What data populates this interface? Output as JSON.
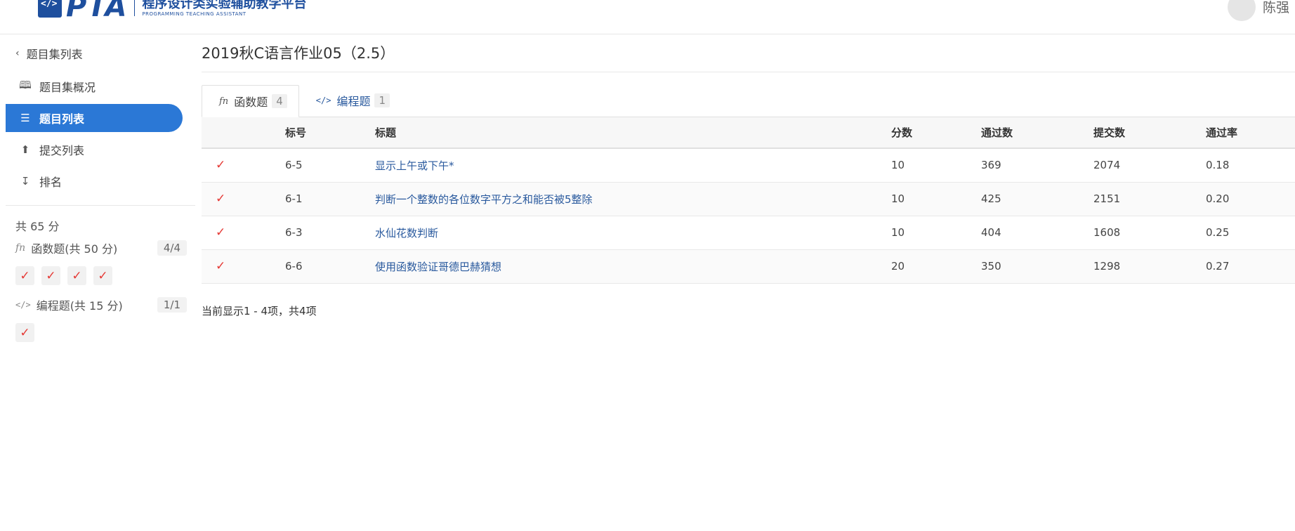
{
  "header": {
    "logo_text": "PTA",
    "logo_title": "程序设计类实验辅助教学平台",
    "logo_subtitle": "PROGRAMMING TEACHING ASSISTANT",
    "user_name": "陈强"
  },
  "sidebar": {
    "back_label": "题目集列表",
    "items": [
      {
        "label": "题目集概况",
        "icon": "book-icon"
      },
      {
        "label": "题目列表",
        "icon": "list-icon",
        "active": true
      },
      {
        "label": "提交列表",
        "icon": "upload-icon"
      },
      {
        "label": "排名",
        "icon": "sort-icon"
      }
    ],
    "total_score": "共 65 分",
    "groups": [
      {
        "label": "函数题(共 50 分)",
        "icon": "fn",
        "badge": "4/4",
        "checks": 4
      },
      {
        "label": "编程题(共 15 分)",
        "icon": "</>",
        "badge": "1/1",
        "checks": 1
      }
    ]
  },
  "main": {
    "title": "2019秋C语言作业05（2.5）",
    "tabs": [
      {
        "label": "函数题",
        "icon": "fn",
        "count": "4",
        "active": true
      },
      {
        "label": "编程题",
        "icon": "</>",
        "count": "1",
        "active": false
      }
    ],
    "table": {
      "headers": [
        "",
        "标号",
        "标题",
        "分数",
        "通过数",
        "提交数",
        "通过率"
      ],
      "rows": [
        {
          "status": "✓",
          "id": "6-5",
          "title": "显示上午或下午*",
          "score": "10",
          "passed": "369",
          "submitted": "2074",
          "rate": "0.18"
        },
        {
          "status": "✓",
          "id": "6-1",
          "title": "判断一个整数的各位数字平方之和能否被5整除",
          "score": "10",
          "passed": "425",
          "submitted": "2151",
          "rate": "0.20"
        },
        {
          "status": "✓",
          "id": "6-3",
          "title": "水仙花数判断",
          "score": "10",
          "passed": "404",
          "submitted": "1608",
          "rate": "0.25"
        },
        {
          "status": "✓",
          "id": "6-6",
          "title": "使用函数验证哥德巴赫猜想",
          "score": "20",
          "passed": "350",
          "submitted": "1298",
          "rate": "0.27"
        }
      ]
    },
    "pager_info": "当前显示1 - 4项，共4项"
  },
  "colors": {
    "brand": "#1e4f9e",
    "active_nav": "#2b78d6",
    "link": "#2a5a9e",
    "check": "#e53935"
  }
}
